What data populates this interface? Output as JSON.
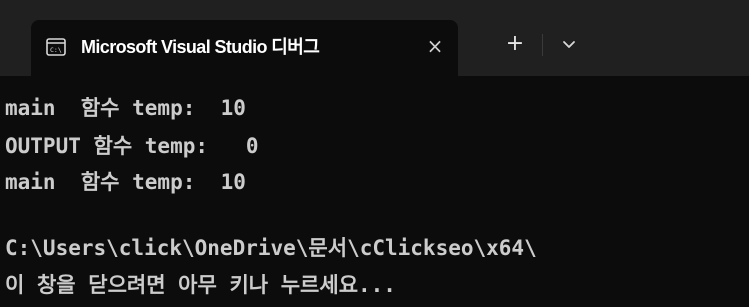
{
  "window": {
    "tab_title": "Microsoft Visual Studio 디버그",
    "tab_close_icon": "×",
    "new_tab_icon": "+",
    "icons": {
      "tab_icon": "console-window-icon",
      "dropdown": "chevron-down-icon"
    }
  },
  "terminal": {
    "lines": [
      "main  함수 temp:  10",
      "OUTPUT 함수 temp:   0",
      "main  함수 temp:  10",
      "",
      "C:\\Users\\click\\OneDrive\\문서\\cClickseo\\x64\\",
      "이 창을 닫으려면 아무 키나 누르세요..."
    ],
    "colors": {
      "background": "#0c0c0c",
      "text": "#cccccc",
      "titlebar": "#202020"
    }
  }
}
